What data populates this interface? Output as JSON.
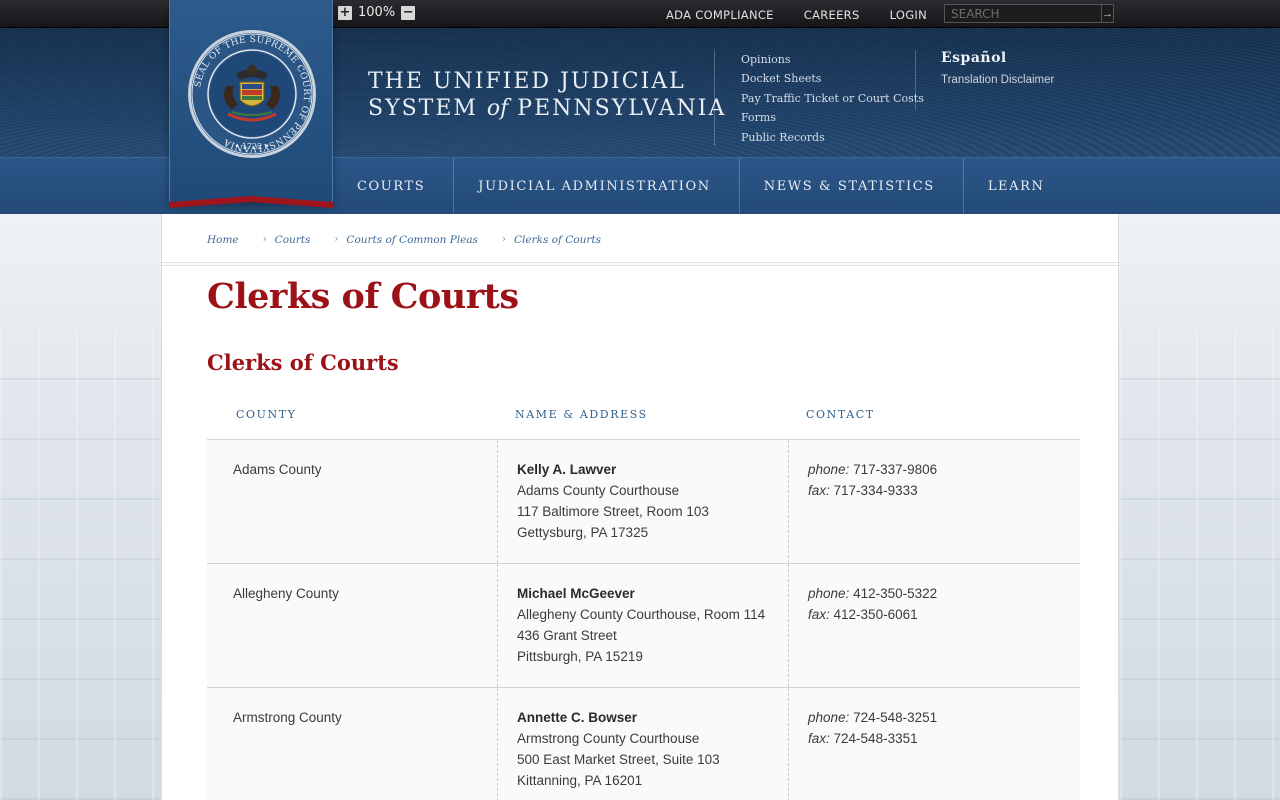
{
  "topbar": {
    "zoom_in_symbol": "+",
    "zoom_value": "100%",
    "zoom_out_symbol": "−",
    "links": [
      "ADA COMPLIANCE",
      "CAREERS",
      "LOGIN"
    ],
    "search_placeholder": "SEARCH",
    "search_go": "→"
  },
  "header": {
    "title_line1": "THE UNIFIED JUDICIAL",
    "title_line2_pre": "SYSTEM ",
    "title_line2_em": "of",
    "title_line2_post": " PENNSYLVANIA",
    "seal_text": "SEAL OF THE SUPREME COURT OF PENNSYLVANIA",
    "seal_year": "1722",
    "quick_links": [
      "Opinions",
      "Docket Sheets",
      "Pay Traffic Ticket or Court Costs",
      "Forms",
      "Public Records"
    ],
    "language": "Español",
    "translation_disclaimer": "Translation Disclaimer"
  },
  "nav": {
    "items": [
      "COURTS",
      "JUDICIAL ADMINISTRATION",
      "NEWS & STATISTICS",
      "LEARN"
    ]
  },
  "breadcrumb": [
    "Home",
    "Courts",
    "Courts of Common Pleas",
    "Clerks of Courts"
  ],
  "page": {
    "title": "Clerks of Courts",
    "section_title": "Clerks of Courts"
  },
  "table": {
    "headers": [
      "COUNTY",
      "NAME & ADDRESS",
      "CONTACT"
    ],
    "phone_label": "phone:",
    "fax_label": "fax:",
    "rows": [
      {
        "county": "Adams County",
        "name": "Kelly A. Lawver",
        "address": [
          "Adams County Courthouse",
          "117 Baltimore Street, Room 103",
          "Gettysburg, PA 17325"
        ],
        "phone": "717-337-9806",
        "fax": "717-334-9333"
      },
      {
        "county": "Allegheny County",
        "name": "Michael McGeever",
        "address": [
          "Allegheny County Courthouse, Room 114",
          "436 Grant Street",
          "Pittsburgh, PA 15219"
        ],
        "phone": "412-350-5322",
        "fax": "412-350-6061"
      },
      {
        "county": "Armstrong County",
        "name": "Annette C. Bowser",
        "address": [
          "Armstrong County Courthouse",
          "500 East Market Street, Suite 103",
          "Kittanning, PA 16201"
        ],
        "phone": "724-548-3251",
        "fax": "724-548-3351"
      }
    ]
  },
  "colors": {
    "heading_red": "#9c1217",
    "link_blue": "#3d6a98",
    "header_navy": "#1e4168",
    "nav_blue": "#2c5688"
  }
}
